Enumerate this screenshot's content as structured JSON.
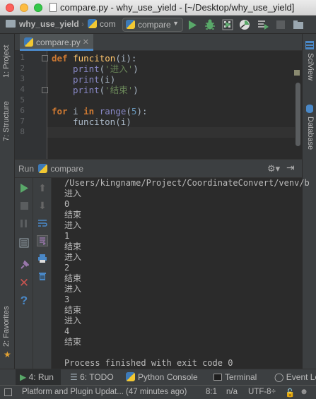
{
  "window": {
    "title": "compare.py - why_use_yield - [~/Desktop/why_use_yield]"
  },
  "navbar": {
    "project": "why_use_yield",
    "file": "com",
    "run_config": "compare"
  },
  "left_tabs": {
    "project": "1: Project",
    "structure": "7: Structure",
    "favorites": "2: Favorites"
  },
  "right_tabs": {
    "sciview": "SciView",
    "database": "Database"
  },
  "editor": {
    "tab_label": "compare.py",
    "line_numbers": [
      "1",
      "2",
      "3",
      "4",
      "5",
      "6",
      "7",
      "8"
    ],
    "code": {
      "l1_kw": "def",
      "l1_name": "funciton",
      "l1_rest": "(i):",
      "l2_fn": "print",
      "l2_open": "(",
      "l2_str": "'进入'",
      "l2_close": ")",
      "l3_fn": "print",
      "l3_rest": "(i)",
      "l4_fn": "print",
      "l4_open": "(",
      "l4_str": "'结束'",
      "l4_close": ")",
      "l6_kw1": "for",
      "l6_var": " i ",
      "l6_kw2": "in",
      "l6_sp": " ",
      "l6_fn": "range",
      "l6_open": "(",
      "l6_num": "5",
      "l6_close": "):",
      "l7_call": "funciton(i)"
    }
  },
  "run_panel": {
    "title_run": "Run",
    "title_config": "compare",
    "output": [
      "/Users/kingname/Project/CoordinateConvert/venv/b",
      "进入",
      "0",
      "结束",
      "进入",
      "1",
      "结束",
      "进入",
      "2",
      "结束",
      "进入",
      "3",
      "结束",
      "进入",
      "4",
      "结束",
      "",
      "Process finished with exit code 0"
    ]
  },
  "bottom_tabs": {
    "run": "4: Run",
    "todo": "6: TODO",
    "python_console": "Python Console",
    "terminal": "Terminal",
    "event_log": "Event Lo"
  },
  "status": {
    "message": "Platform and Plugin Updat... (47 minutes ago)",
    "position": "8:1",
    "separator": "n/a",
    "encoding": "UTF-8÷"
  },
  "colors": {
    "keyword": "#cc7832",
    "function": "#ffc66d",
    "string": "#6a8759",
    "number": "#6897bb",
    "run_green": "#59a869",
    "stop_red": "#c75450"
  }
}
